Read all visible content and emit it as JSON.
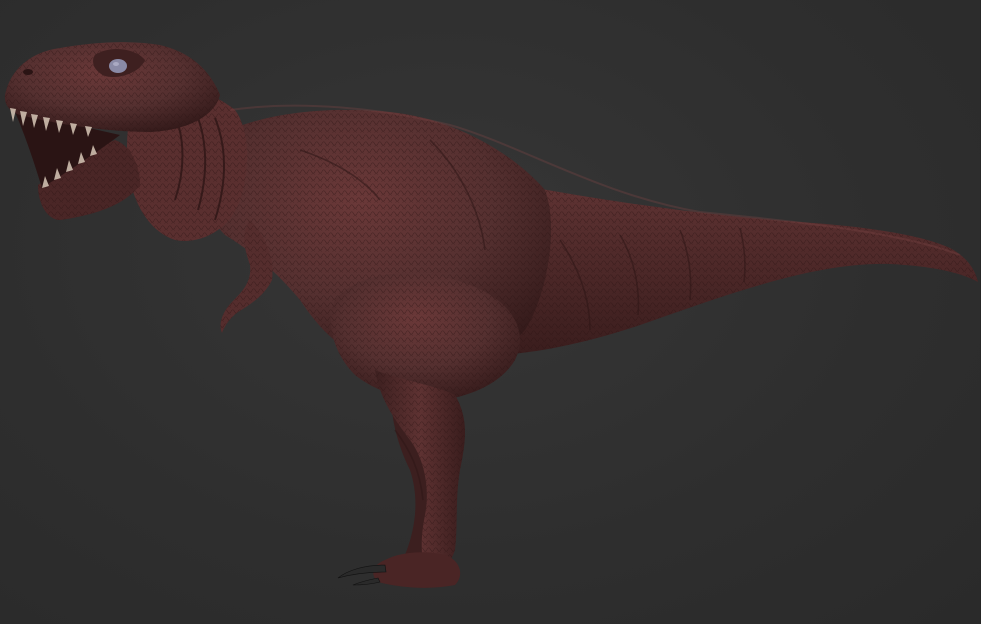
{
  "scene": {
    "subject_icon": "tyrannosaurus-sculpt",
    "background_color": "#2f2f2f",
    "material": {
      "base_color": "#5a2e2e",
      "shadow_color": "#2e1616",
      "highlight_color": "#7a4646",
      "eye_color": "#8a8aa6"
    }
  }
}
